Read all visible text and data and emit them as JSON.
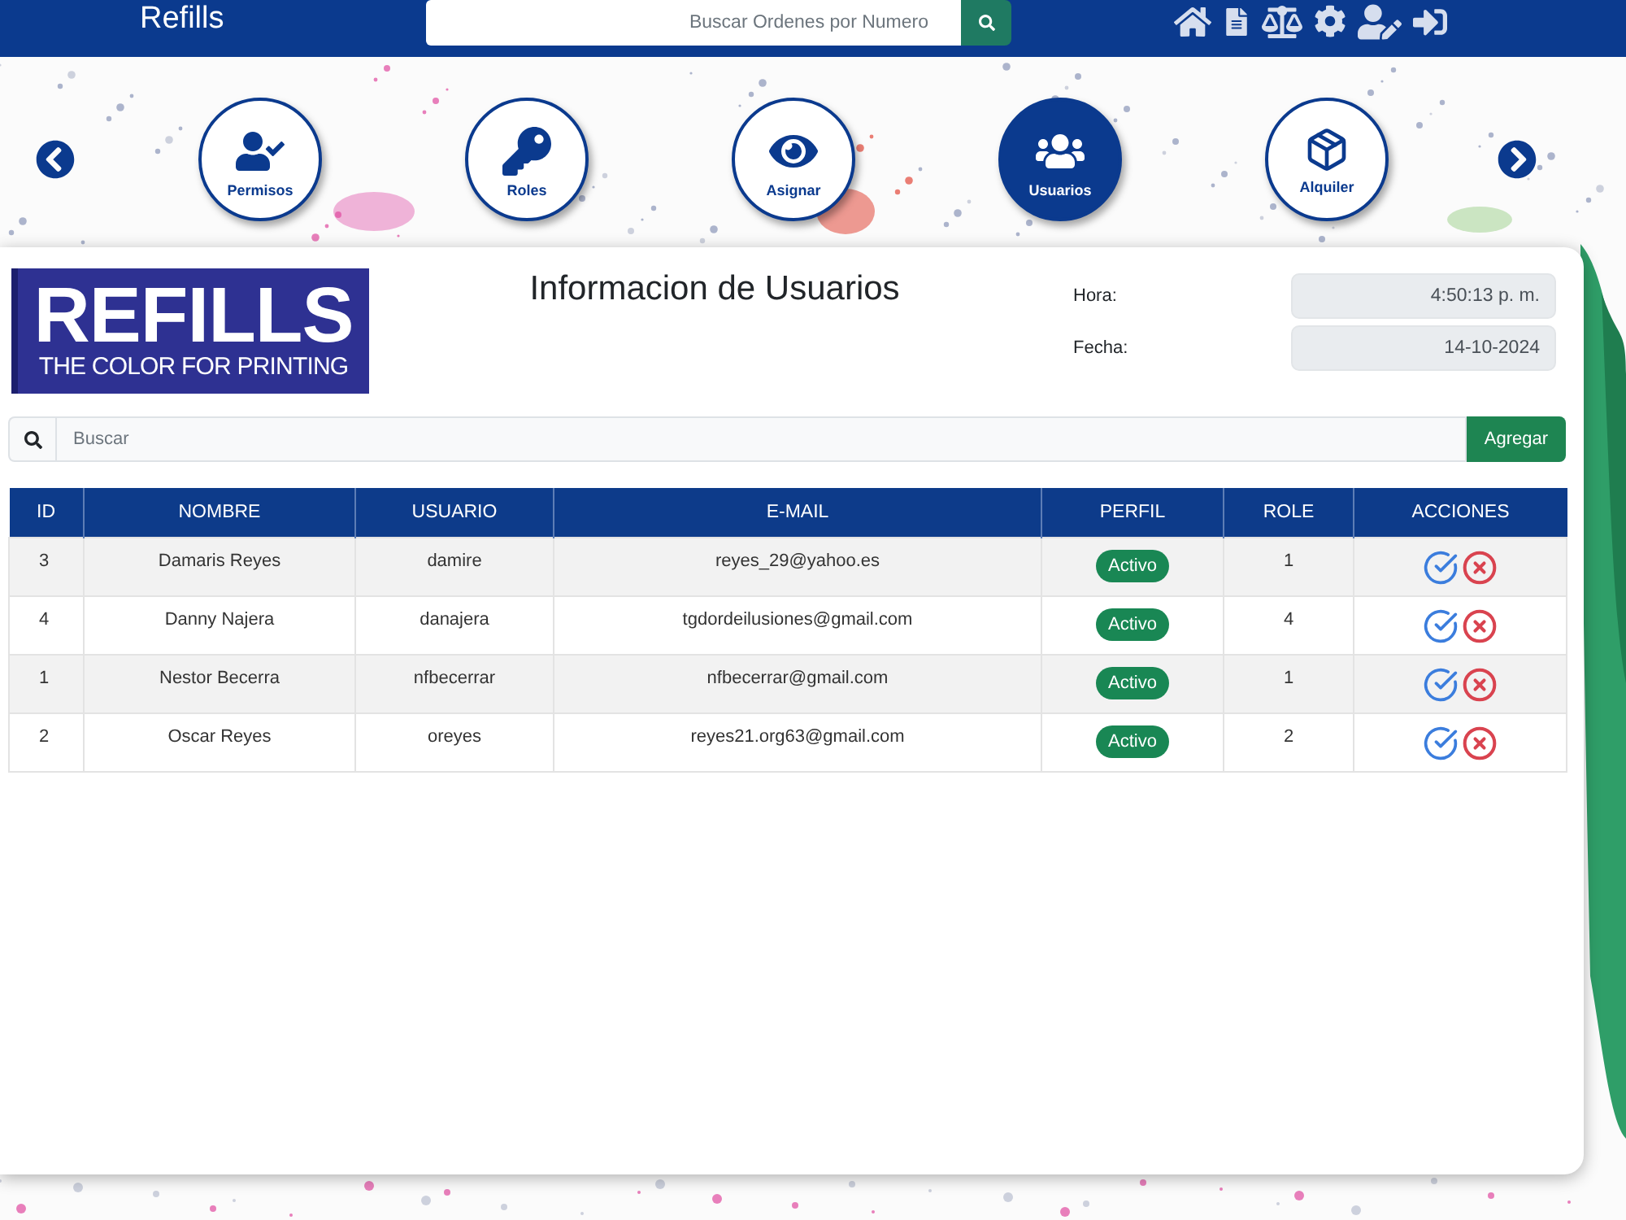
{
  "navbar": {
    "brand": "Refills",
    "search": {
      "placeholder": "Buscar Ordenes por Numero"
    }
  },
  "carousel": {
    "items": [
      {
        "label": "Permisos",
        "selected": false
      },
      {
        "label": "Roles",
        "selected": false
      },
      {
        "label": "Asignar",
        "selected": false
      },
      {
        "label": "Usuarios",
        "selected": true
      },
      {
        "label": "Alquiler",
        "selected": false
      }
    ]
  },
  "header": {
    "logo": {
      "wordmark": "REFILLS",
      "tagline": "THE COLOR FOR PRINTING"
    },
    "title": "Informacion de Usuarios",
    "fields": [
      {
        "label": "Hora:",
        "value": "4:50:13 p. m."
      },
      {
        "label": "Fecha:",
        "value": "14-10-2024"
      }
    ]
  },
  "toolbar": {
    "search": {
      "placeholder": "Buscar"
    },
    "add_button": "Agregar"
  },
  "table": {
    "columns": [
      "ID",
      "NOMBRE",
      "USUARIO",
      "E-MAIL",
      "PERFIL",
      "ROLE",
      "ACCIONES"
    ],
    "rows": [
      {
        "id": "3",
        "nombre": "Damaris Reyes",
        "usuario": "damire",
        "email": "reyes_29@yahoo.es",
        "perfil": "Activo",
        "role": "1"
      },
      {
        "id": "4",
        "nombre": "Danny Najera",
        "usuario": "danajera",
        "email": "tgdordeilusiones@gmail.com",
        "perfil": "Activo",
        "role": "4"
      },
      {
        "id": "1",
        "nombre": "Nestor Becerra",
        "usuario": "nfbecerrar",
        "email": "nfbecerrar@gmail.com",
        "perfil": "Activo",
        "role": "1"
      },
      {
        "id": "2",
        "nombre": "Oscar Reyes",
        "usuario": "oreyes",
        "email": "reyes21.org63@gmail.com",
        "perfil": "Activo",
        "role": "2"
      }
    ]
  }
}
